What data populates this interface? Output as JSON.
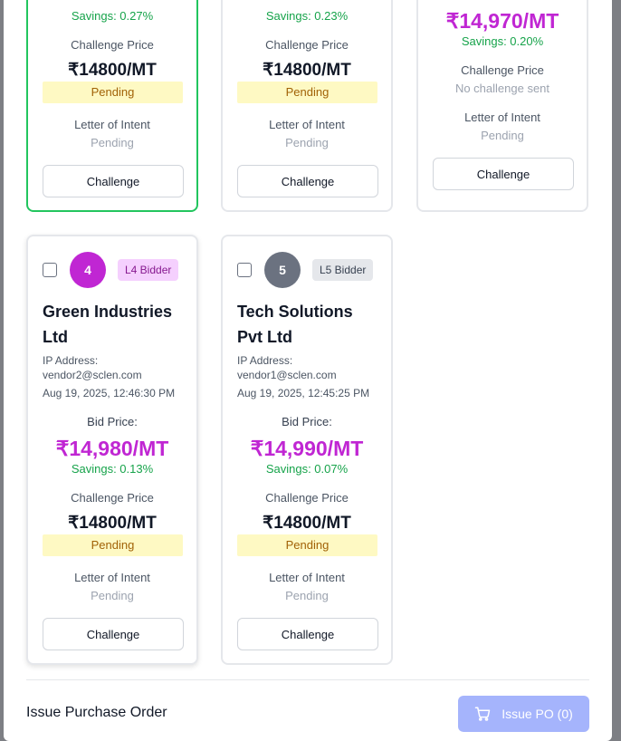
{
  "top_cards": [
    {
      "savings": "Savings: 0.27%",
      "challenge_price_label": "Challenge Price",
      "challenge_price": "₹14800/MT",
      "challenge_status": "Pending",
      "loi_label": "Letter of Intent",
      "loi_status": "Pending",
      "button": "Challenge"
    },
    {
      "savings": "Savings: 0.23%",
      "challenge_price_label": "Challenge Price",
      "challenge_price": "₹14800/MT",
      "challenge_status": "Pending",
      "loi_label": "Letter of Intent",
      "loi_status": "Pending",
      "button": "Challenge"
    },
    {
      "bid_price": "₹14,970/MT",
      "savings": "Savings: 0.20%",
      "challenge_price_label": "Challenge Price",
      "challenge_status": "No challenge sent",
      "loi_label": "Letter of Intent",
      "loi_status": "Pending",
      "button": "Challenge"
    }
  ],
  "bottom_cards": [
    {
      "rank": "4",
      "rank_color": "#c026d3",
      "bidder_label": "L4 Bidder",
      "vendor": "Green Industries Ltd",
      "ip_label": "IP Address:",
      "email": "vendor2@sclen.com",
      "timestamp": "Aug 19, 2025, 12:46:30 PM",
      "bid_price_label": "Bid Price:",
      "bid_price": "₹14,980/MT",
      "savings": "Savings: 0.13%",
      "challenge_price_label": "Challenge Price",
      "challenge_price": "₹14800/MT",
      "challenge_status": "Pending",
      "loi_label": "Letter of Intent",
      "loi_status": "Pending",
      "button": "Challenge"
    },
    {
      "rank": "5",
      "rank_color": "#6b7280",
      "bidder_label": "L5 Bidder",
      "vendor": "Tech Solutions Pvt Ltd",
      "ip_label": "IP Address:",
      "email": "vendor1@sclen.com",
      "timestamp": "Aug 19, 2025, 12:45:25 PM",
      "bid_price_label": "Bid Price:",
      "bid_price": "₹14,990/MT",
      "savings": "Savings: 0.07%",
      "challenge_price_label": "Challenge Price",
      "challenge_price": "₹14800/MT",
      "challenge_status": "Pending",
      "loi_label": "Letter of Intent",
      "loi_status": "Pending",
      "button": "Challenge"
    }
  ],
  "footer": {
    "title": "Issue Purchase Order",
    "issue_button": "Issue PO (0)",
    "issue_icon": "cart-icon"
  },
  "colors": {
    "accent_price": "#c026d3",
    "savings": "#16a34a",
    "selected_border": "#22c55e",
    "pending_bg": "#fef9c3",
    "issue_button_bg": "#a5b4fc"
  }
}
